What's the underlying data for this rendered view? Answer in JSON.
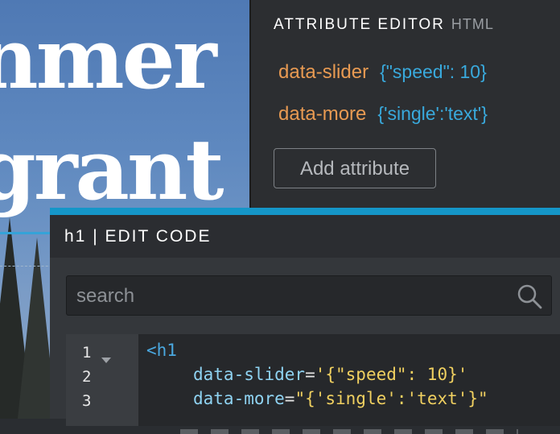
{
  "background": {
    "heading_line1": "nmer",
    "heading_line2": "grant"
  },
  "attribute_editor": {
    "title": "ATTRIBUTE EDITOR",
    "subtitle": "HTML",
    "attributes": [
      {
        "name": "data-slider",
        "value": "{\"speed\": 10}"
      },
      {
        "name": "data-more",
        "value": "{'single':'text'}"
      }
    ],
    "add_button_label": "Add attribute",
    "colors": {
      "name": "#e89a52",
      "value": "#39a9dc"
    }
  },
  "code_panel": {
    "title": "h1 | EDIT CODE",
    "accent_color": "#1596c8",
    "search": {
      "placeholder": "search",
      "value": "",
      "icon": "search-icon"
    },
    "line_numbers": [
      "1",
      "2",
      "3"
    ],
    "code": {
      "line1_tag": "<h1",
      "line2_attr": "data-slider",
      "line2_eq": "=",
      "line2_val": "'{\"speed\": 10}'",
      "line3_attr": "data-more",
      "line3_eq": "=",
      "line3_val": "\"{'single':'text'}\""
    }
  }
}
